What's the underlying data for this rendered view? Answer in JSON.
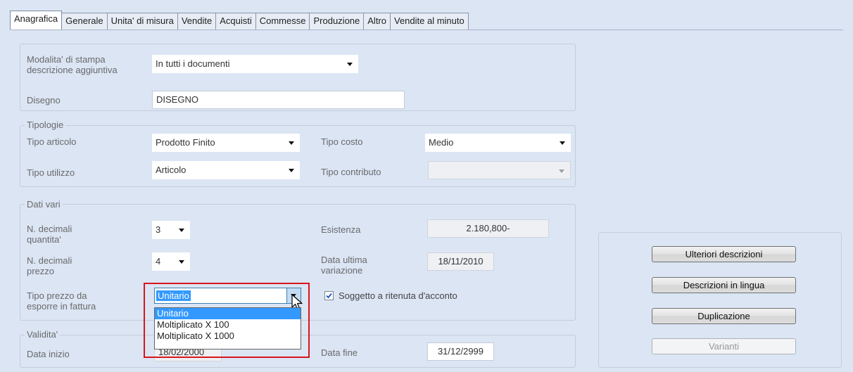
{
  "tabs": [
    {
      "label": "Anagrafica",
      "active": true
    },
    {
      "label": "Generale"
    },
    {
      "label": "Unita' di misura"
    },
    {
      "label": "Vendite"
    },
    {
      "label": "Acquisti"
    },
    {
      "label": "Commesse"
    },
    {
      "label": "Produzione"
    },
    {
      "label": "Altro"
    },
    {
      "label": "Vendite al minuto"
    }
  ],
  "top": {
    "stampa_label": "Modalita' di stampa\ndescrizione aggiuntiva",
    "stampa_value": "In tutti i documenti",
    "disegno_label": "Disegno",
    "disegno_value": "DISEGNO"
  },
  "tipologie": {
    "legend": "Tipologie",
    "tipo_articolo_label": "Tipo articolo",
    "tipo_articolo_value": "Prodotto Finito",
    "tipo_costo_label": "Tipo costo",
    "tipo_costo_value": "Medio",
    "tipo_utilizzo_label": "Tipo utilizzo",
    "tipo_utilizzo_value": "Articolo",
    "tipo_contributo_label": "Tipo contributo",
    "tipo_contributo_value": ""
  },
  "dati_vari": {
    "legend": "Dati vari",
    "dec_qta_label": "N. decimali\nquantita'",
    "dec_qta_value": "3",
    "esistenza_label": "Esistenza",
    "esistenza_value": "2.180,800-",
    "dec_prezzo_label": "N. decimali\nprezzo",
    "dec_prezzo_value": "4",
    "data_var_label": "Data ultima\nvariazione",
    "data_var_value": "18/11/2010",
    "tipo_prezzo_label": "Tipo prezzo da\nesporre in fattura",
    "tipo_prezzo_value": "Unitario",
    "tipo_prezzo_options": [
      "Unitario",
      "Moltiplicato X 100",
      "Moltiplicato X 1000"
    ],
    "ritenuta_label": "Soggetto a ritenuta  d'acconto",
    "ritenuta_checked": true
  },
  "validita": {
    "legend": "Validita'",
    "data_inizio_label": "Data inizio",
    "data_inizio_value": "18/02/2000",
    "data_fine_label": "Data fine",
    "data_fine_value": "31/12/2999"
  },
  "actions": {
    "ulteriori": "Ulteriori descrizioni",
    "lingua": "Descrizioni  in lingua",
    "duplicazione": "Duplicazione",
    "varianti": "Varianti"
  }
}
